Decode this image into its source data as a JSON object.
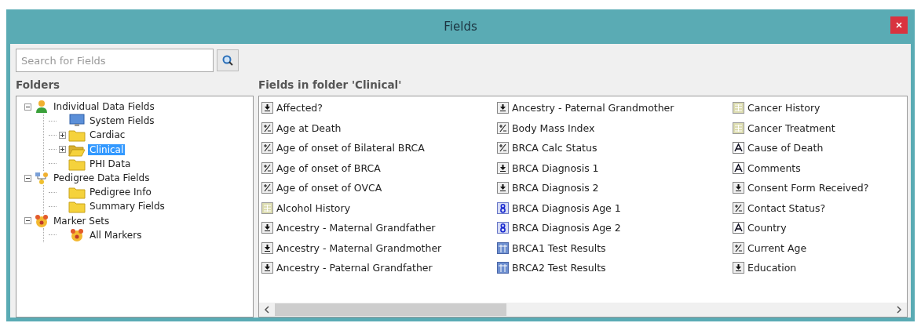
{
  "window": {
    "title": "Fields"
  },
  "search": {
    "placeholder": "Search for Fields"
  },
  "folders": {
    "label": "Folders",
    "tree": [
      {
        "label": "Individual Data Fields",
        "kind": "person",
        "expanded": true,
        "selected": false,
        "children": [
          {
            "label": "System Fields",
            "kind": "monitor",
            "selected": false
          },
          {
            "label": "Cardiac",
            "kind": "folder",
            "expanded": false,
            "selected": false
          },
          {
            "label": "Clinical",
            "kind": "openfolder",
            "expanded": false,
            "selected": true
          },
          {
            "label": "PHI Data",
            "kind": "folder",
            "selected": false
          }
        ]
      },
      {
        "label": "Pedigree Data Fields",
        "kind": "pedigree",
        "expanded": true,
        "selected": false,
        "children": [
          {
            "label": "Pedigree Info",
            "kind": "folder",
            "selected": false
          },
          {
            "label": "Summary Fields",
            "kind": "folder",
            "selected": false
          }
        ]
      },
      {
        "label": "Marker Sets",
        "kind": "markers",
        "expanded": true,
        "selected": false,
        "children": [
          {
            "label": "All Markers",
            "kind": "markers",
            "selected": false
          }
        ]
      }
    ]
  },
  "fields": {
    "heading": "Fields in folder 'Clinical'",
    "items": [
      {
        "label": "Affected?",
        "kind": "choice"
      },
      {
        "label": "Age at Death",
        "kind": "numeric"
      },
      {
        "label": "Age of onset of Bilateral BRCA",
        "kind": "numeric"
      },
      {
        "label": "Age of onset of BRCA",
        "kind": "numeric"
      },
      {
        "label": "Age of onset of OVCA",
        "kind": "numeric"
      },
      {
        "label": "Alcohol History",
        "kind": "list"
      },
      {
        "label": "Ancestry - Maternal Grandfather",
        "kind": "choice"
      },
      {
        "label": "Ancestry - Maternal Grandmother",
        "kind": "choice"
      },
      {
        "label": "Ancestry - Paternal Grandfather",
        "kind": "choice"
      },
      {
        "label": "Ancestry - Paternal Grandmother",
        "kind": "choice"
      },
      {
        "label": "Body Mass Index",
        "kind": "numeric"
      },
      {
        "label": "BRCA Calc Status",
        "kind": "numeric"
      },
      {
        "label": "BRCA Diagnosis 1",
        "kind": "choice"
      },
      {
        "label": "BRCA Diagnosis 2",
        "kind": "choice"
      },
      {
        "label": "BRCA Diagnosis Age 1",
        "kind": "integer"
      },
      {
        "label": "BRCA Diagnosis Age 2",
        "kind": "integer"
      },
      {
        "label": "BRCA1 Test Results",
        "kind": "table"
      },
      {
        "label": "BRCA2 Test Results",
        "kind": "table"
      },
      {
        "label": "Cancer History",
        "kind": "list"
      },
      {
        "label": "Cancer Treatment",
        "kind": "list"
      },
      {
        "label": "Cause of Death",
        "kind": "text"
      },
      {
        "label": "Comments",
        "kind": "text"
      },
      {
        "label": "Consent Form Received?",
        "kind": "choice"
      },
      {
        "label": "Contact Status?",
        "kind": "numeric"
      },
      {
        "label": "Country",
        "kind": "text"
      },
      {
        "label": "Current Age",
        "kind": "numeric"
      },
      {
        "label": "Education",
        "kind": "choice"
      }
    ]
  }
}
